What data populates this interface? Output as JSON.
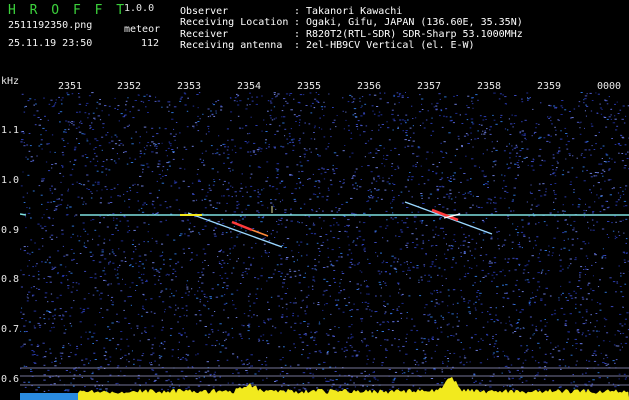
{
  "header": {
    "app_name": "H R O F F T",
    "app_version": "1.0.0",
    "filename": "2511192350.png",
    "datetime": "25.11.19 23:50",
    "mode_label": "meteor",
    "count": "112",
    "info": [
      {
        "label": "Observer",
        "value": "Takanori Kawachi"
      },
      {
        "label": "Receiving Location",
        "value": "Ogaki, Gifu, JAPAN (136.60E, 35.35N)"
      },
      {
        "label": "Receiver",
        "value": "R820T2(RTL-SDR) SDR-Sharp 53.1000MHz"
      },
      {
        "label": "Receiving antenna",
        "value": "2el-HB9CV Vertical (el. E-W)"
      }
    ]
  },
  "axes": {
    "y_unit": "kHz",
    "x_ticks": [
      "2351",
      "2352",
      "2353",
      "2354",
      "2355",
      "2356",
      "2357",
      "2358",
      "2359",
      "0000"
    ],
    "y_ticks": [
      "1.1",
      "1.0",
      "0.9",
      "0.8",
      "0.7",
      "0.6"
    ]
  },
  "colors": {
    "background": "#000000",
    "noise": "#1e2a9a",
    "carrier": "#7fe0e0",
    "echo": "#ff3a3a",
    "spectrum": "#f2ea1e",
    "app_name": "#3cd23c"
  }
}
